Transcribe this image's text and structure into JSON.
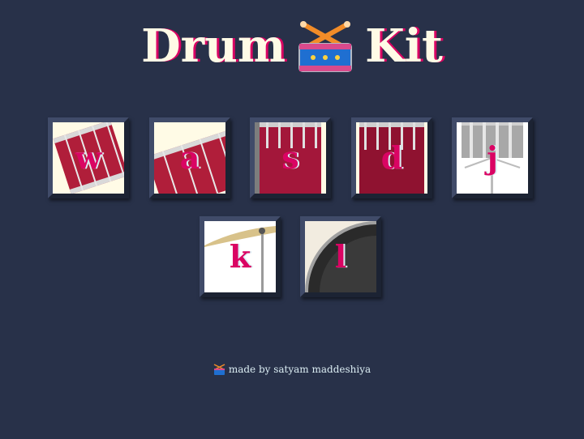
{
  "header": {
    "title_left": "Drum",
    "title_right": "Kit",
    "icon": "drum-icon"
  },
  "keys": [
    {
      "letter": "w",
      "instrument_icon": "tom-drum-icon"
    },
    {
      "letter": "a",
      "instrument_icon": "tom-drum-icon"
    },
    {
      "letter": "s",
      "instrument_icon": "snare-drum-icon"
    },
    {
      "letter": "d",
      "instrument_icon": "snare-drum-icon"
    },
    {
      "letter": "j",
      "instrument_icon": "steel-drum-icon"
    },
    {
      "letter": "k",
      "instrument_icon": "crash-cymbal-icon"
    },
    {
      "letter": "l",
      "instrument_icon": "kick-drum-icon"
    }
  ],
  "footer": {
    "text": "made by satyam maddeshiya",
    "icon": "drum-icon"
  },
  "colors": {
    "background": "#283149",
    "accent": "#da0463",
    "cream": "#fffbe6",
    "tile_border": "#404b69"
  }
}
